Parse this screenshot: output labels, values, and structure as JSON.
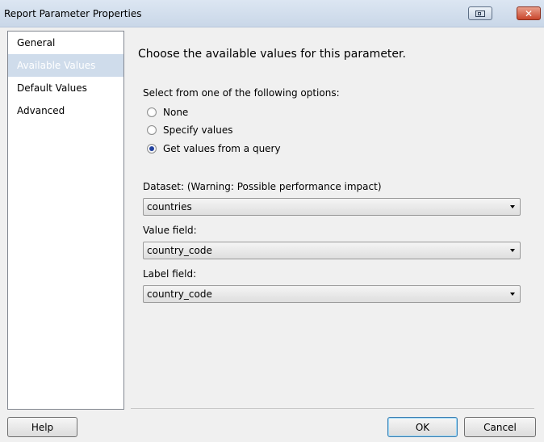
{
  "window": {
    "title": "Report Parameter Properties"
  },
  "sidebar": {
    "items": [
      {
        "label": "General",
        "active": false
      },
      {
        "label": "Available Values",
        "active": true
      },
      {
        "label": "Default Values",
        "active": false
      },
      {
        "label": "Advanced",
        "active": false
      }
    ]
  },
  "main": {
    "heading": "Choose the available values for this parameter.",
    "options_label": "Select from one of the following options:",
    "options": [
      {
        "label": "None",
        "checked": false
      },
      {
        "label": "Specify values",
        "checked": false
      },
      {
        "label": "Get values from a query",
        "checked": true
      }
    ],
    "dataset": {
      "label": "Dataset: (Warning: Possible performance impact)",
      "value": "countries"
    },
    "value_field": {
      "label": "Value field:",
      "value": "country_code"
    },
    "label_field": {
      "label": "Label field:",
      "value": "country_code"
    }
  },
  "footer": {
    "help": "Help",
    "ok": "OK",
    "cancel": "Cancel"
  },
  "colors": {
    "active_item": "#cfdceb",
    "titlebar": "#dce6f2",
    "close_button": "#c9462c"
  }
}
